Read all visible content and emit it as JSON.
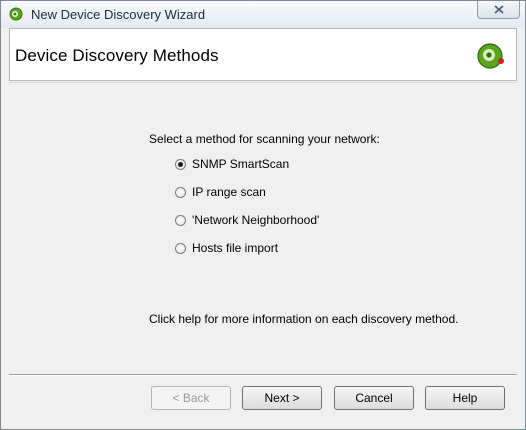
{
  "window": {
    "title": "New Device Discovery Wizard"
  },
  "header": {
    "title": "Device Discovery Methods",
    "icon": "green-disc-icon"
  },
  "content": {
    "prompt": "Select a method for scanning your network:",
    "options": [
      {
        "label": "SNMP SmartScan",
        "checked": true
      },
      {
        "label": "IP range scan",
        "checked": false
      },
      {
        "label": "'Network Neighborhood'",
        "checked": false
      },
      {
        "label": "Hosts file import",
        "checked": false
      }
    ],
    "help_note": "Click help for more information on each discovery method."
  },
  "buttons": {
    "back": "< Back",
    "next": "Next >",
    "cancel": "Cancel",
    "help": "Help"
  },
  "colors": {
    "accent_green": "#5aa51e",
    "accent_red": "#d0201c"
  }
}
